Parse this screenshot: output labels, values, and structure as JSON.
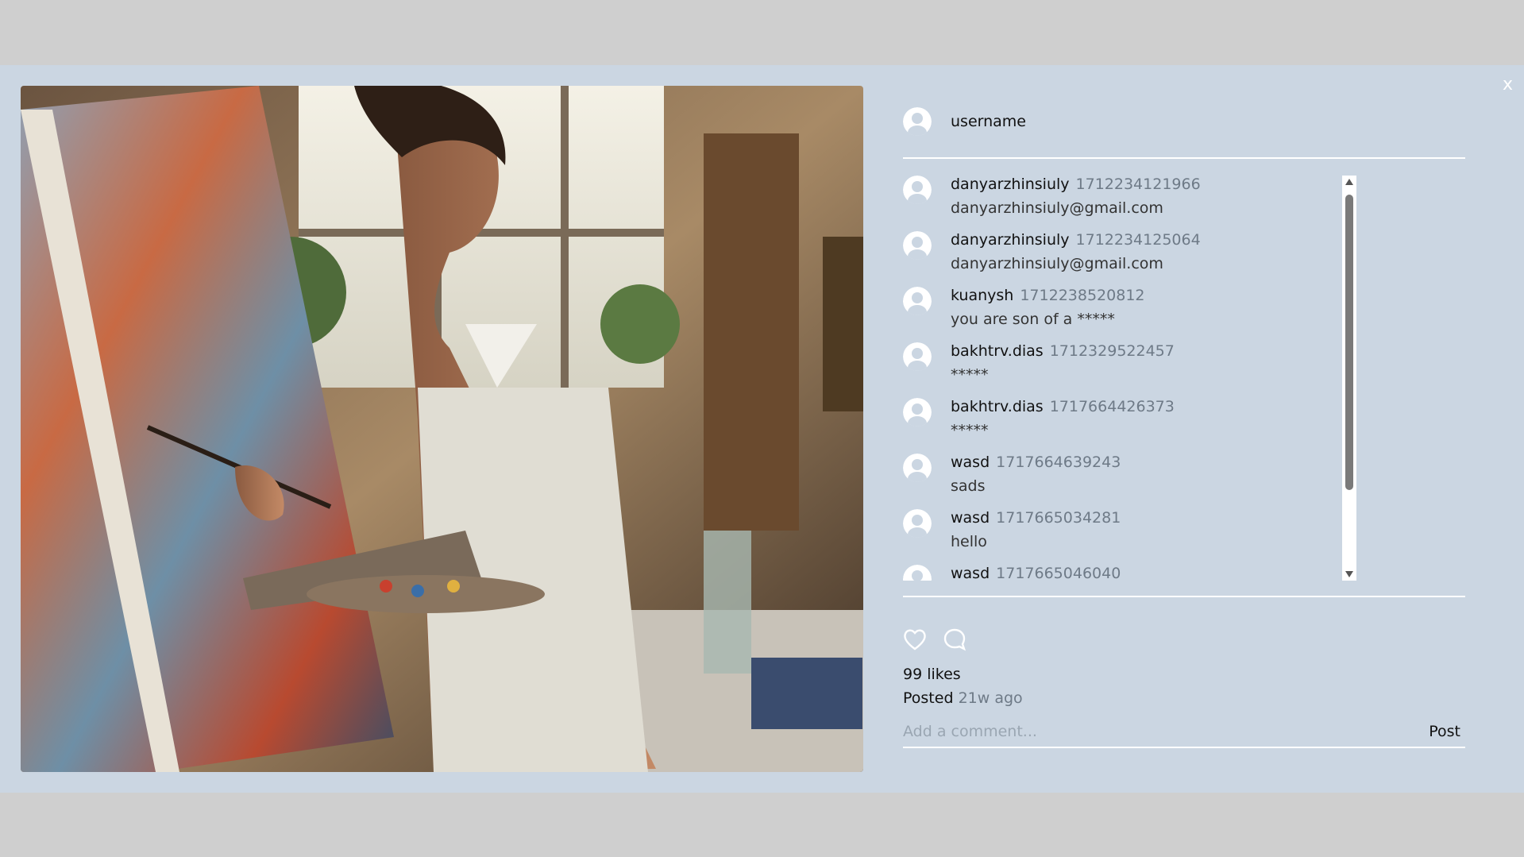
{
  "modal": {
    "close_label": "x"
  },
  "post": {
    "author": "username",
    "likes_text": "99 likes",
    "posted_label": "Posted",
    "posted_ago": "21w ago",
    "comment_placeholder": "Add a comment...",
    "post_button": "Post"
  },
  "comments": [
    {
      "user": "danyarzhinsiuly",
      "timestamp": "1712234121966",
      "text": "danyarzhinsiuly@gmail.com"
    },
    {
      "user": "danyarzhinsiuly",
      "timestamp": "1712234125064",
      "text": "danyarzhinsiuly@gmail.com"
    },
    {
      "user": "kuanysh",
      "timestamp": "1712238520812",
      "text": "you are son of a *****"
    },
    {
      "user": "bakhtrv.dias",
      "timestamp": "1712329522457",
      "text": "*****"
    },
    {
      "user": "bakhtrv.dias",
      "timestamp": "1717664426373",
      "text": "*****"
    },
    {
      "user": "wasd",
      "timestamp": "1717664639243",
      "text": "sads"
    },
    {
      "user": "wasd",
      "timestamp": "1717665034281",
      "text": "hello"
    },
    {
      "user": "wasd",
      "timestamp": "1717665046040",
      "text": ""
    }
  ],
  "icons": {
    "like": "heart-icon",
    "comment": "comment-bubble-icon",
    "avatar": "user-avatar-icon"
  }
}
